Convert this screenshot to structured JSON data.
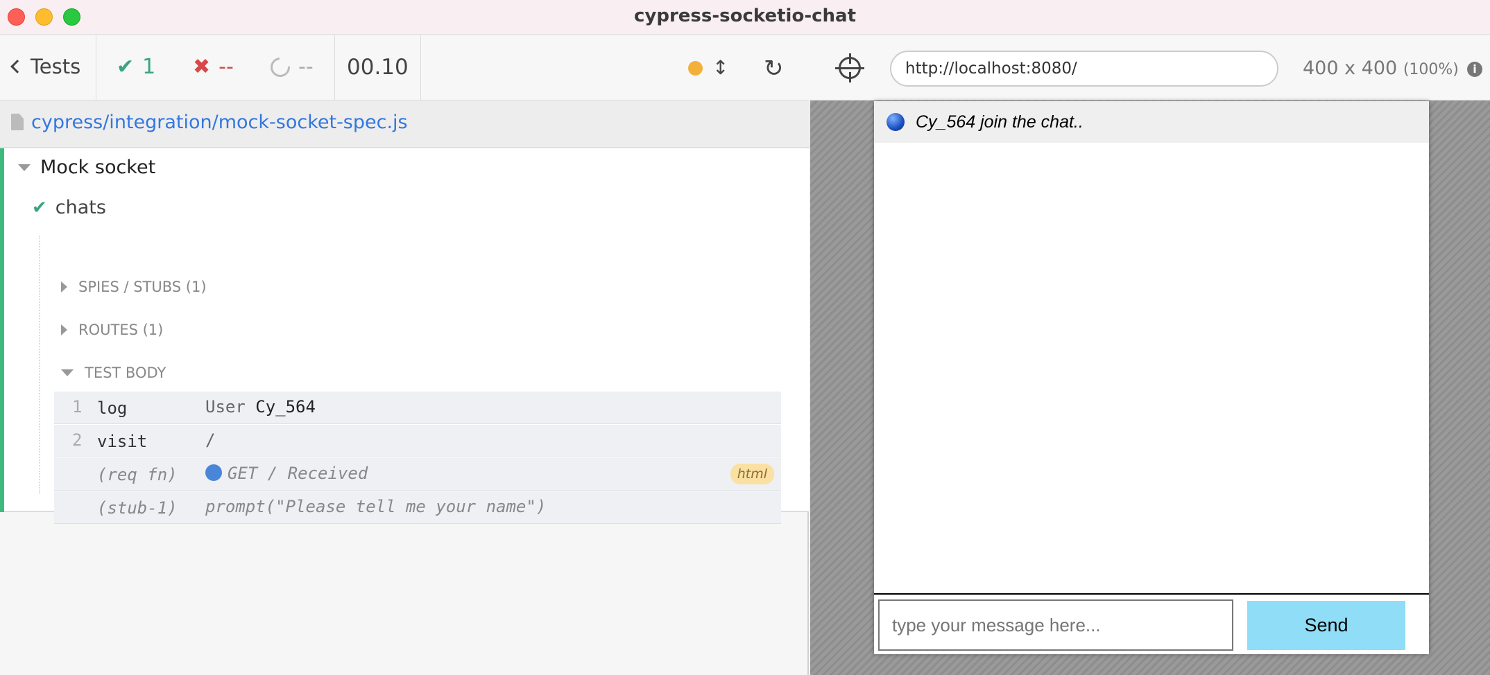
{
  "window": {
    "title": "cypress-socketio-chat"
  },
  "toolbar": {
    "back_label": "Tests",
    "passed": "1",
    "failed": "--",
    "pending": "--",
    "duration": "00.10"
  },
  "spec": {
    "path": "cypress/integration/mock-socket-spec.js"
  },
  "suite": {
    "name": "Mock socket"
  },
  "test": {
    "name": "chats"
  },
  "sections": {
    "spies": "SPIES / STUBS (1)",
    "routes": "ROUTES (1)",
    "body": "TEST BODY"
  },
  "commands": [
    {
      "num": "1",
      "name": "log",
      "msg_prefix": "User ",
      "msg_value": "Cy_564"
    },
    {
      "num": "2",
      "name": "visit",
      "msg": "/"
    },
    {
      "num": "",
      "name": "(req fn)",
      "msg": "GET / Received",
      "badge": "html"
    },
    {
      "num": "",
      "name": "(stub-1)",
      "msg": "prompt(\"Please tell me your name\")"
    }
  ],
  "browser": {
    "url": "http://localhost:8080/",
    "size": "400 x 400",
    "zoom": "(100%)"
  },
  "app": {
    "joined_message": "Cy_564 join the chat..",
    "input_placeholder": "type your message here...",
    "send_label": "Send"
  },
  "colors": {
    "accent": "#3fba7f",
    "pass": "#3aa57c",
    "fail": "#d94848",
    "send_button": "#8fddf6"
  }
}
